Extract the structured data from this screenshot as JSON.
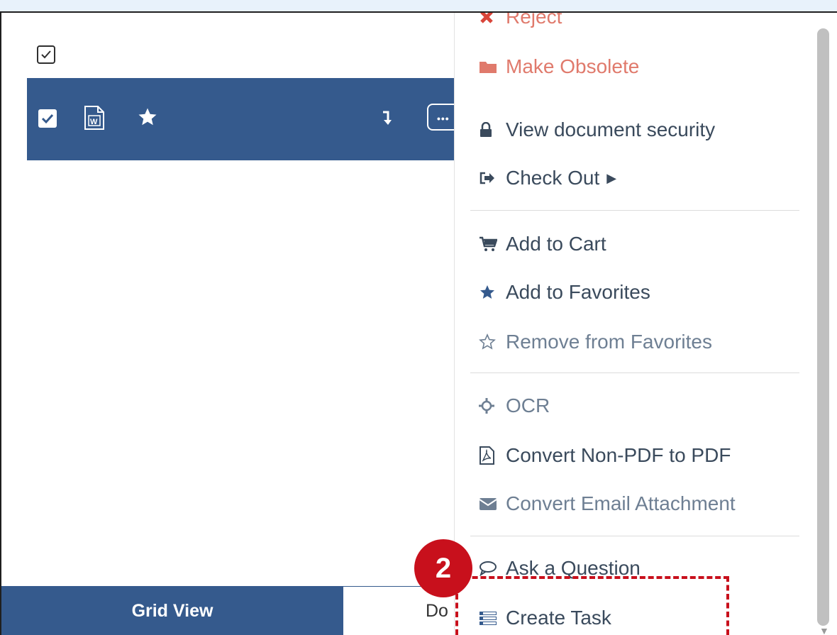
{
  "list": {
    "grid_tab_label": "Grid View",
    "doc_tab_label": "Do"
  },
  "context_menu": {
    "items": [
      {
        "label": "Reject",
        "icon": "x-icon",
        "style": "danger"
      },
      {
        "label": "Make Obsolete",
        "icon": "folder-icon",
        "style": "danger"
      },
      {
        "label": "View document security",
        "icon": "lock-icon",
        "style": "normal"
      },
      {
        "label": "Check Out",
        "icon": "checkout-icon",
        "style": "normal"
      },
      {
        "label": "Add to Cart",
        "icon": "cart-icon",
        "style": "normal"
      },
      {
        "label": "Add to Favorites",
        "icon": "star-icon",
        "style": "normal"
      },
      {
        "label": "Remove from Favorites",
        "icon": "star-outline-icon",
        "style": "muted"
      },
      {
        "label": "OCR",
        "icon": "ocr-icon",
        "style": "muted"
      },
      {
        "label": "Convert Non-PDF to PDF",
        "icon": "pdf-icon",
        "style": "normal"
      },
      {
        "label": "Convert Email Attachment",
        "icon": "envelope-icon",
        "style": "muted"
      },
      {
        "label": "Ask a Question",
        "icon": "speech-bubble-icon",
        "style": "normal"
      },
      {
        "label": "Create Task",
        "icon": "task-icon",
        "style": "normal"
      }
    ]
  },
  "annotation": {
    "step_number": "2"
  },
  "colors": {
    "row_selected": "#355a8d",
    "danger": "#e07a6c",
    "annotation_red": "#c8101c"
  }
}
